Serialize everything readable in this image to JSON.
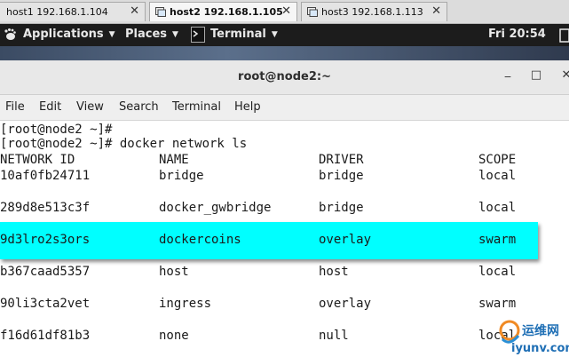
{
  "tabs": [
    {
      "label": "host1 192.168.1.104",
      "active": false
    },
    {
      "label": "host2 192.168.1.105",
      "active": true
    },
    {
      "label": "host3 192.168.1.113",
      "active": false
    }
  ],
  "topbar": {
    "applications": "Applications",
    "places": "Places",
    "terminal": "Terminal",
    "clock": "Fri 20:54"
  },
  "window": {
    "title": "root@node2:~",
    "minimize": "_",
    "maximize": "□",
    "close": "✕"
  },
  "menu": [
    "File",
    "Edit",
    "View",
    "Search",
    "Terminal",
    "Help"
  ],
  "terminal": {
    "prompt1": "[root@node2 ~]#",
    "prompt2": "[root@node2 ~]# docker network ls",
    "headers": [
      "NETWORK ID",
      "NAME",
      "DRIVER",
      "SCOPE"
    ],
    "rows": [
      [
        "10af0fb24711",
        "bridge",
        "bridge",
        "local"
      ],
      [
        "289d8e513c3f",
        "docker_gwbridge",
        "bridge",
        "local"
      ],
      [
        "9d3lro2s3ors",
        "dockercoins",
        "overlay",
        "swarm"
      ],
      [
        "b367caad5357",
        "host",
        "host",
        "local"
      ],
      [
        "90li3cta2vet",
        "ingress",
        "overlay",
        "swarm"
      ],
      [
        "f16d61df81b3",
        "none",
        "null",
        "local"
      ]
    ],
    "highlight_color": "#00ffff"
  },
  "watermark": {
    "line1": "运维网",
    "line2": "iyunv.com"
  }
}
